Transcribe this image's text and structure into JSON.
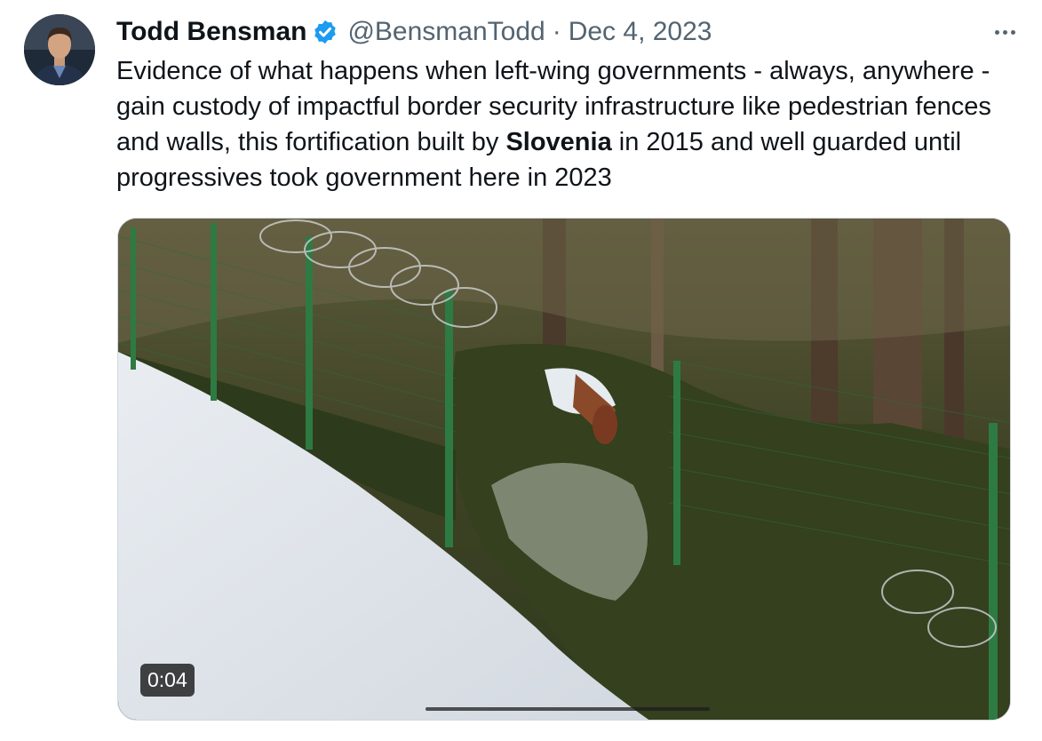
{
  "author": {
    "display_name": "Todd Bensman",
    "handle": "@BensmanTodd",
    "separator": "·",
    "date": "Dec 4, 2023"
  },
  "text": {
    "part1": "Evidence of what happens when left-wing governments - always, anywhere - gain custody of impactful border security infrastructure like pedestrian fences and walls, this fortification built by ",
    "bold": "Slovenia",
    "part2": " in 2015 and well guarded until progressives took government here in 2023"
  },
  "media": {
    "type": "video",
    "duration": "0:04",
    "progress_fraction": 0.02
  },
  "icons": {
    "verified": "verified-badge-icon",
    "more": "more-options-icon"
  },
  "colors": {
    "verified_blue": "#1d9bf0",
    "secondary_text": "#536471",
    "border": "#cfd9de"
  }
}
